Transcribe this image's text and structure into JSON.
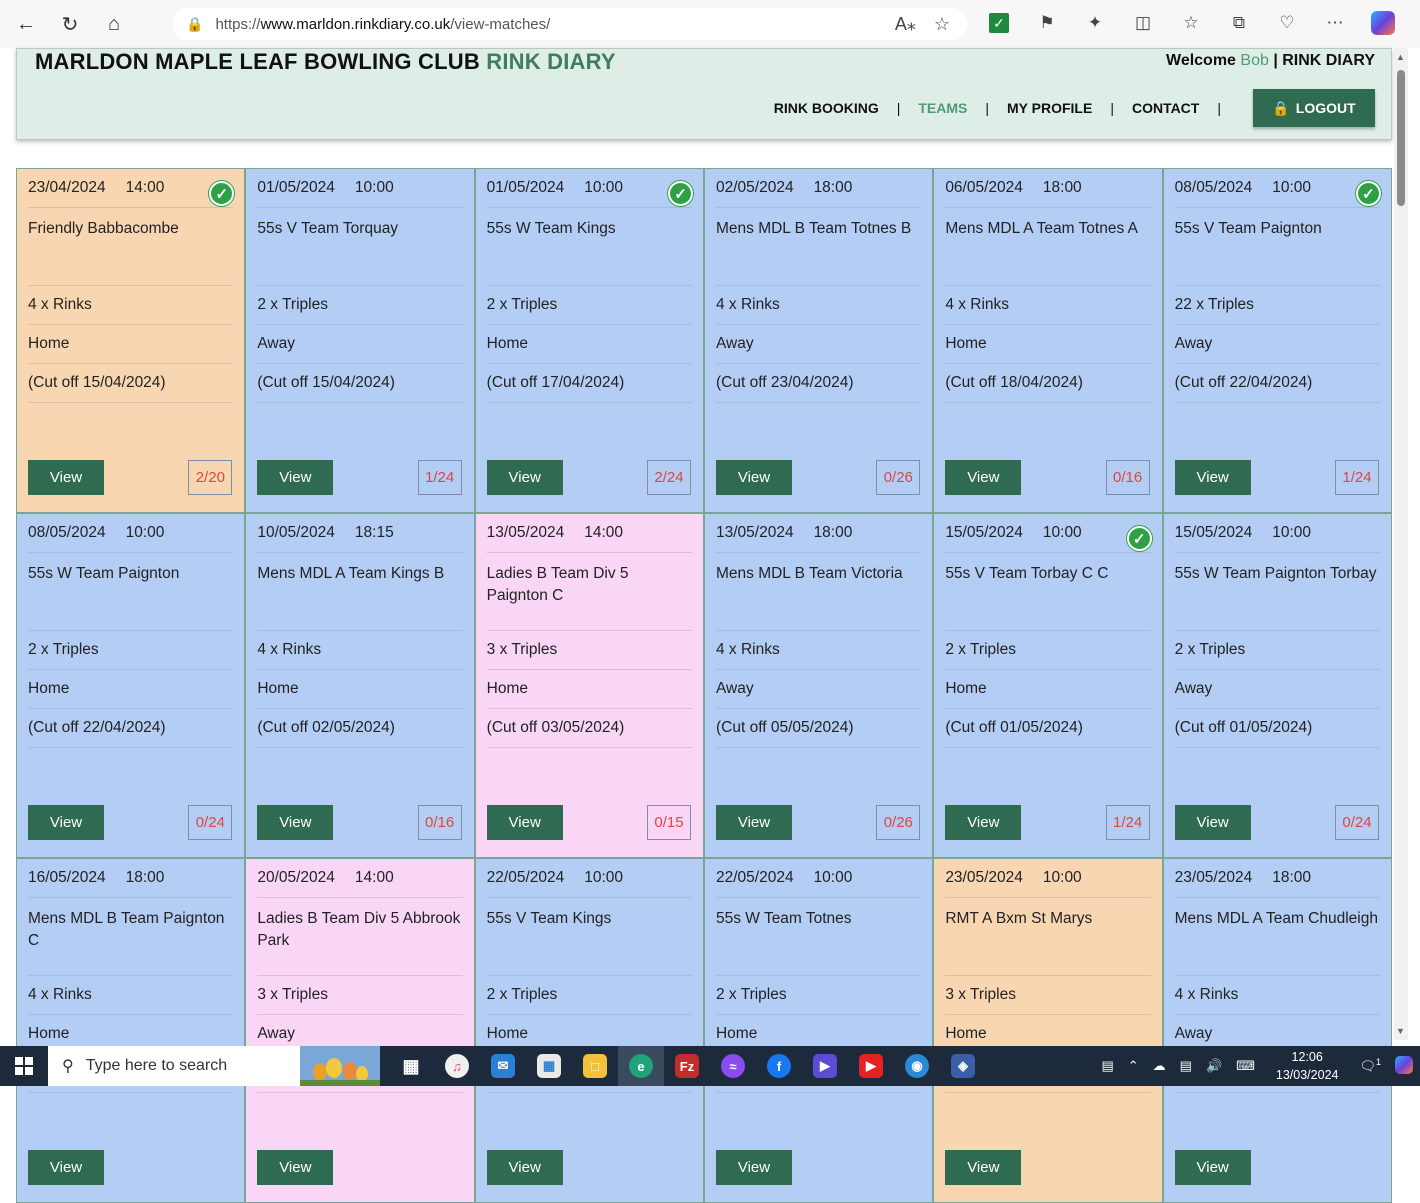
{
  "browser": {
    "url_scheme": "https://",
    "url_domain": "www.marldon.rinkdiary.co.uk",
    "url_path": "/view-matches/"
  },
  "header": {
    "title_main": "MARLDON MAPLE LEAF BOWLING CLUB",
    "title_accent": "RINK DIARY",
    "welcome_prefix": "Welcome",
    "user": "Bob",
    "welcome_suffix": "| RINK DIARY",
    "nav": {
      "rink_booking": "RINK BOOKING",
      "teams": "TEAMS",
      "my_profile": "MY PROFILE",
      "contact": "CONTACT",
      "logout": "LOGOUT"
    },
    "nav_separator": "|"
  },
  "view_label": "View",
  "matches": [
    {
      "date": "23/04/2024",
      "time": "14:00",
      "title": "Friendly Babbacombe",
      "format": "4 x Rinks",
      "venue": "Home",
      "cutoff": "(Cut off 15/04/2024)",
      "count": "2/20",
      "color": "orange",
      "confirmed": true
    },
    {
      "date": "01/05/2024",
      "time": "10:00",
      "title": "55s V Team Torquay",
      "format": "2 x Triples",
      "venue": "Away",
      "cutoff": "(Cut off 15/04/2024)",
      "count": "1/24",
      "color": "blue",
      "confirmed": false
    },
    {
      "date": "01/05/2024",
      "time": "10:00",
      "title": "55s W Team Kings",
      "format": "2 x Triples",
      "venue": "Home",
      "cutoff": "(Cut off 17/04/2024)",
      "count": "2/24",
      "color": "blue",
      "confirmed": true
    },
    {
      "date": "02/05/2024",
      "time": "18:00",
      "title": "Mens MDL B Team Totnes B",
      "format": "4 x Rinks",
      "venue": "Away",
      "cutoff": "(Cut off 23/04/2024)",
      "count": "0/26",
      "color": "blue",
      "confirmed": false
    },
    {
      "date": "06/05/2024",
      "time": "18:00",
      "title": "Mens MDL A Team Totnes A",
      "format": "4 x Rinks",
      "venue": "Home",
      "cutoff": "(Cut off 18/04/2024)",
      "count": "0/16",
      "color": "blue",
      "confirmed": false
    },
    {
      "date": "08/05/2024",
      "time": "10:00",
      "title": "55s V Team Paignton",
      "format": "22 x Triples",
      "venue": "Away",
      "cutoff": "(Cut off 22/04/2024)",
      "count": "1/24",
      "color": "blue",
      "confirmed": true
    },
    {
      "date": "08/05/2024",
      "time": "10:00",
      "title": "55s W Team Paignton",
      "format": "2 x Triples",
      "venue": "Home",
      "cutoff": "(Cut off 22/04/2024)",
      "count": "0/24",
      "color": "blue",
      "confirmed": false
    },
    {
      "date": "10/05/2024",
      "time": "18:15",
      "title": "Mens MDL A Team Kings B",
      "format": "4 x Rinks",
      "venue": "Home",
      "cutoff": "(Cut off 02/05/2024)",
      "count": "0/16",
      "color": "blue",
      "confirmed": false
    },
    {
      "date": "13/05/2024",
      "time": "14:00",
      "title": "Ladies B Team Div 5 Paignton C",
      "format": "3 x Triples",
      "venue": "Home",
      "cutoff": "(Cut off 03/05/2024)",
      "count": "0/15",
      "color": "pink",
      "confirmed": false
    },
    {
      "date": "13/05/2024",
      "time": "18:00",
      "title": "Mens MDL B Team Victoria",
      "format": "4 x Rinks",
      "venue": "Away",
      "cutoff": "(Cut off 05/05/2024)",
      "count": "0/26",
      "color": "blue",
      "confirmed": false
    },
    {
      "date": "15/05/2024",
      "time": "10:00",
      "title": "55s V Team Torbay C C",
      "format": "2 x Triples",
      "venue": "Home",
      "cutoff": "(Cut off 01/05/2024)",
      "count": "1/24",
      "color": "blue",
      "confirmed": true
    },
    {
      "date": "15/05/2024",
      "time": "10:00",
      "title": "55s W Team Paignton Torbay",
      "format": "2 x Triples",
      "venue": "Away",
      "cutoff": "(Cut off 01/05/2024)",
      "count": "0/24",
      "color": "blue",
      "confirmed": false
    },
    {
      "date": "16/05/2024",
      "time": "18:00",
      "title": "Mens MDL B Team Paignton C",
      "format": "4 x Rinks",
      "venue": "Home",
      "cutoff": "",
      "count": "",
      "color": "blue",
      "confirmed": false
    },
    {
      "date": "20/05/2024",
      "time": "14:00",
      "title": "Ladies B Team Div 5 Abbrook Park",
      "format": "3 x Triples",
      "venue": "Away",
      "cutoff": "",
      "count": "",
      "color": "pink",
      "confirmed": false
    },
    {
      "date": "22/05/2024",
      "time": "10:00",
      "title": "55s V Team Kings",
      "format": "2 x Triples",
      "venue": "Home",
      "cutoff": "",
      "count": "",
      "color": "blue",
      "confirmed": false
    },
    {
      "date": "22/05/2024",
      "time": "10:00",
      "title": "55s W Team Totnes",
      "format": "2 x Triples",
      "venue": "Home",
      "cutoff": "",
      "count": "",
      "color": "blue",
      "confirmed": false
    },
    {
      "date": "23/05/2024",
      "time": "10:00",
      "title": "RMT A Bxm St Marys",
      "format": "3 x Triples",
      "venue": "Home",
      "cutoff": "",
      "count": "",
      "color": "orange",
      "confirmed": false
    },
    {
      "date": "23/05/2024",
      "time": "18:00",
      "title": "Mens MDL A Team Chudleigh",
      "format": "4 x Rinks",
      "venue": "Away",
      "cutoff": "",
      "count": "",
      "color": "blue",
      "confirmed": false
    }
  ],
  "taskbar": {
    "search_placeholder": "Type here to search",
    "time": "12:06",
    "date": "13/03/2024",
    "notification_count": "1"
  },
  "colors": {
    "header_bg": "#deeee6",
    "accent_green": "#3f7d5e",
    "button_green": "#2e6b50",
    "card_blue": "#b3cdf5",
    "card_orange": "#f9d6b2",
    "card_pink": "#f9d6f5",
    "count_red": "#e0463f"
  }
}
